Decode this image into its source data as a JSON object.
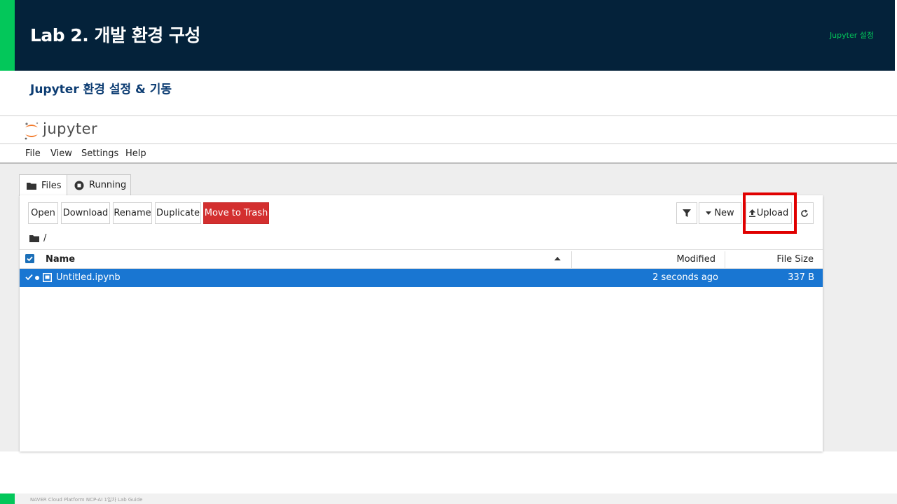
{
  "slide": {
    "title": "Lab 2. 개발 환경 구성",
    "header_right": "Jupyter 설정",
    "subtitle": "Jupyter 환경 설정 & 기동",
    "footer": "NAVER Cloud Platform  NCP-AI 1일차 Lab Guide"
  },
  "jupyter": {
    "logo_text": "jupyter",
    "menu": [
      "File",
      "View",
      "Settings",
      "Help"
    ],
    "tabs": [
      {
        "label": "Files",
        "icon": "folder-icon",
        "active": true
      },
      {
        "label": "Running",
        "icon": "stop-circle-icon",
        "active": false
      }
    ],
    "toolbar": {
      "open": "Open",
      "download": "Download",
      "rename": "Rename",
      "duplicate": "Duplicate",
      "move_to_trash": "Move to Trash",
      "new": "New",
      "upload": "Upload"
    },
    "breadcrumb": "/",
    "columns": {
      "name": "Name",
      "modified": "Modified",
      "size": "File Size"
    },
    "files": [
      {
        "name": "Untitled.ipynb",
        "modified": "2 seconds ago",
        "size": "337 B",
        "selected": true,
        "running": true
      }
    ]
  },
  "colors": {
    "header_bg": "#04223a",
    "accent_green": "#03c75a",
    "subtitle": "#0d3d73",
    "selection": "#1976d2",
    "danger": "#d32f2f",
    "highlight": "#e00000"
  }
}
